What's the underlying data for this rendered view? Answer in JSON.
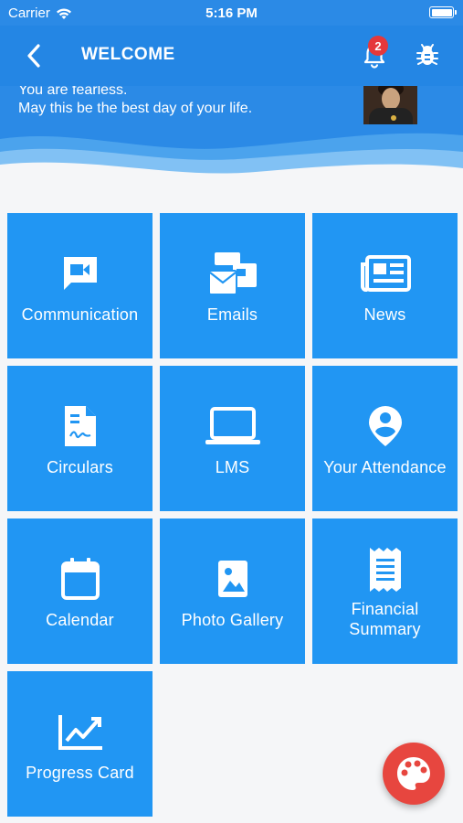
{
  "status": {
    "carrier": "Carrier",
    "time": "5:16 PM"
  },
  "appbar": {
    "title": "WELCOME",
    "notification_count": "2"
  },
  "greeting": {
    "line1": "You are fearless.",
    "line2": "May this be the best day of your life."
  },
  "tiles": [
    {
      "label": "Communication",
      "icon": "video-chat-icon"
    },
    {
      "label": "Emails",
      "icon": "email-icon"
    },
    {
      "label": "News",
      "icon": "newspaper-icon"
    },
    {
      "label": "Circulars",
      "icon": "document-icon"
    },
    {
      "label": "LMS",
      "icon": "laptop-icon"
    },
    {
      "label": "Your Attendance",
      "icon": "person-pin-icon"
    },
    {
      "label": "Calendar",
      "icon": "calendar-icon"
    },
    {
      "label": "Photo Gallery",
      "icon": "photo-icon"
    },
    {
      "label": "Financial\nSummary",
      "icon": "receipt-icon"
    },
    {
      "label": "Progress Card",
      "icon": "chart-line-icon"
    }
  ],
  "colors": {
    "primary": "#2196f3",
    "appbar": "#2486e4",
    "fab": "#e7463f",
    "badge": "#e5383b"
  },
  "fab": {
    "icon": "palette-icon"
  }
}
